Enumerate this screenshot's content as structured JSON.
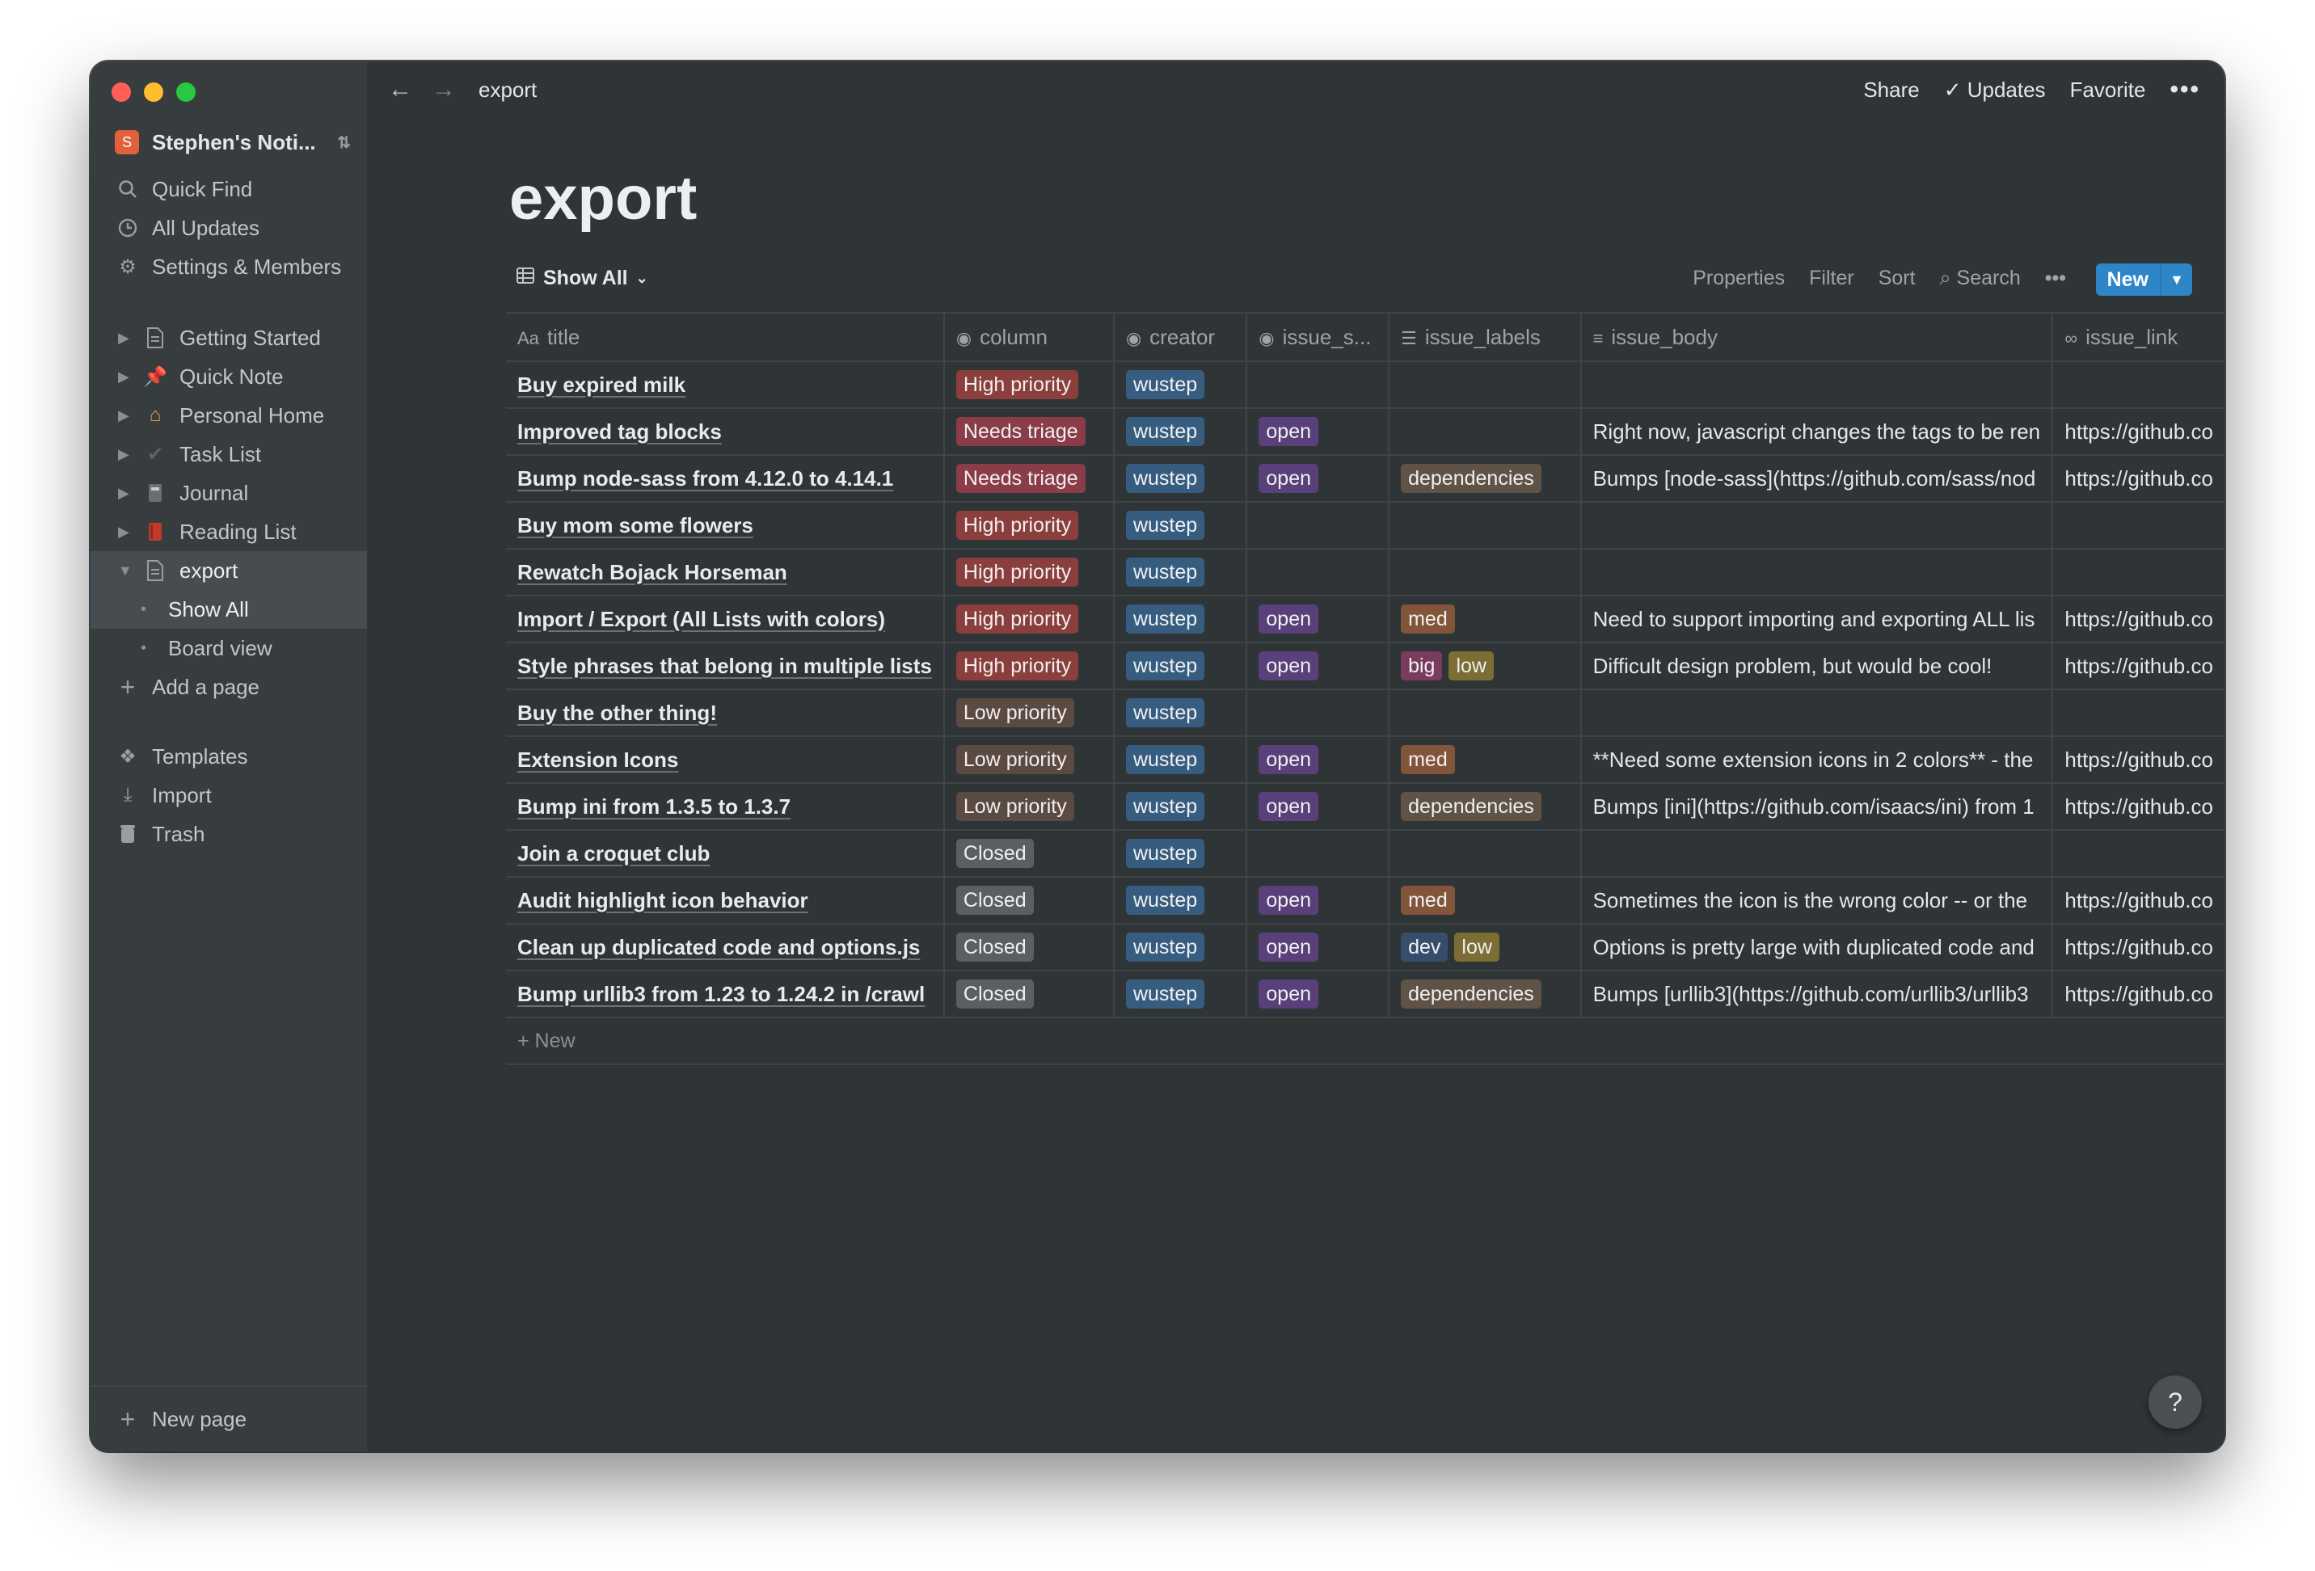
{
  "window": {
    "breadcrumb": "export"
  },
  "sidebar": {
    "workspace": {
      "icon": "S",
      "name": "Stephen's Noti..."
    },
    "top_items": [
      {
        "label": "Quick Find",
        "icon": "search-icon"
      },
      {
        "label": "All Updates",
        "icon": "clock-icon"
      },
      {
        "label": "Settings & Members",
        "icon": "gear-icon"
      }
    ],
    "pages": [
      {
        "label": "Getting Started",
        "icon": "page-icon"
      },
      {
        "label": "Quick Note",
        "icon": "pushpin-icon"
      },
      {
        "label": "Personal Home",
        "icon": "house-icon"
      },
      {
        "label": "Task List",
        "icon": "checkmark-icon"
      },
      {
        "label": "Journal",
        "icon": "notebook-icon"
      },
      {
        "label": "Reading List",
        "icon": "book-icon"
      },
      {
        "label": "export",
        "icon": "page-icon"
      }
    ],
    "subpages": [
      {
        "label": "Show All"
      },
      {
        "label": "Board view"
      }
    ],
    "add_page": "Add a page",
    "bottom_items": [
      {
        "label": "Templates",
        "icon": "templates-icon"
      },
      {
        "label": "Import",
        "icon": "import-icon"
      },
      {
        "label": "Trash",
        "icon": "trash-icon"
      }
    ],
    "new_page": "New page"
  },
  "topbar": {
    "share": "Share",
    "updates": "Updates",
    "favorite": "Favorite"
  },
  "page": {
    "title": "export"
  },
  "viewbar": {
    "view_name": "Show All",
    "properties": "Properties",
    "filter": "Filter",
    "sort": "Sort",
    "search": "Search",
    "new": "New"
  },
  "table": {
    "headers": [
      "title",
      "column",
      "creator",
      "issue_s...",
      "issue_labels",
      "issue_body",
      "issue_link"
    ],
    "rows": [
      {
        "title": "Buy expired milk",
        "column": "High priority",
        "creator": "wustep",
        "status": "",
        "labels": [],
        "body": "",
        "link": ""
      },
      {
        "title": "Improved tag blocks",
        "column": "Needs triage",
        "creator": "wustep",
        "status": "open",
        "labels": [],
        "body": "Right now, javascript changes the tags to be ren",
        "link": "https://github.co"
      },
      {
        "title": "Bump node-sass from 4.12.0 to 4.14.1",
        "column": "Needs triage",
        "creator": "wustep",
        "status": "open",
        "labels": [
          "dependencies"
        ],
        "body": "Bumps [node-sass](https://github.com/sass/nod",
        "link": "https://github.co"
      },
      {
        "title": "Buy mom some flowers",
        "column": "High priority",
        "creator": "wustep",
        "status": "",
        "labels": [],
        "body": "",
        "link": ""
      },
      {
        "title": "Rewatch Bojack Horseman",
        "column": "High priority",
        "creator": "wustep",
        "status": "",
        "labels": [],
        "body": "",
        "link": ""
      },
      {
        "title": "Import / Export (All Lists with colors)",
        "column": "High priority",
        "creator": "wustep",
        "status": "open",
        "labels": [
          "med"
        ],
        "body": "Need to support importing and exporting ALL lis",
        "link": "https://github.co"
      },
      {
        "title": "Style phrases that belong in multiple lists",
        "column": "High priority",
        "creator": "wustep",
        "status": "open",
        "labels": [
          "big",
          "low"
        ],
        "body": "Difficult design problem, but would be cool!",
        "link": "https://github.co"
      },
      {
        "title": "Buy the other thing!",
        "column": "Low priority",
        "creator": "wustep",
        "status": "",
        "labels": [],
        "body": "",
        "link": ""
      },
      {
        "title": "Extension Icons",
        "column": "Low priority",
        "creator": "wustep",
        "status": "open",
        "labels": [
          "med"
        ],
        "body": "**Need some extension icons in 2 colors** - the",
        "link": "https://github.co"
      },
      {
        "title": "Bump ini from 1.3.5 to 1.3.7",
        "column": "Low priority",
        "creator": "wustep",
        "status": "open",
        "labels": [
          "dependencies"
        ],
        "body": "Bumps [ini](https://github.com/isaacs/ini) from 1",
        "link": "https://github.co"
      },
      {
        "title": "Join a croquet club",
        "column": "Closed",
        "creator": "wustep",
        "status": "",
        "labels": [],
        "body": "",
        "link": ""
      },
      {
        "title": "Audit highlight icon behavior",
        "column": "Closed",
        "creator": "wustep",
        "status": "open",
        "labels": [
          "med"
        ],
        "body": "Sometimes the icon is the wrong color -- or the",
        "link": "https://github.co"
      },
      {
        "title": "Clean up duplicated code and options.js",
        "column": "Closed",
        "creator": "wustep",
        "status": "open",
        "labels": [
          "dev",
          "low"
        ],
        "body": "Options is pretty large with duplicated code and",
        "link": "https://github.co"
      },
      {
        "title": "Bump urllib3 from 1.23 to 1.24.2 in /crawl",
        "column": "Closed",
        "creator": "wustep",
        "status": "open",
        "labels": [
          "dependencies"
        ],
        "body": "Bumps [urllib3](https://github.com/urllib3/urllib3",
        "link": "https://github.co"
      }
    ],
    "new_row": "New"
  },
  "help": "?"
}
